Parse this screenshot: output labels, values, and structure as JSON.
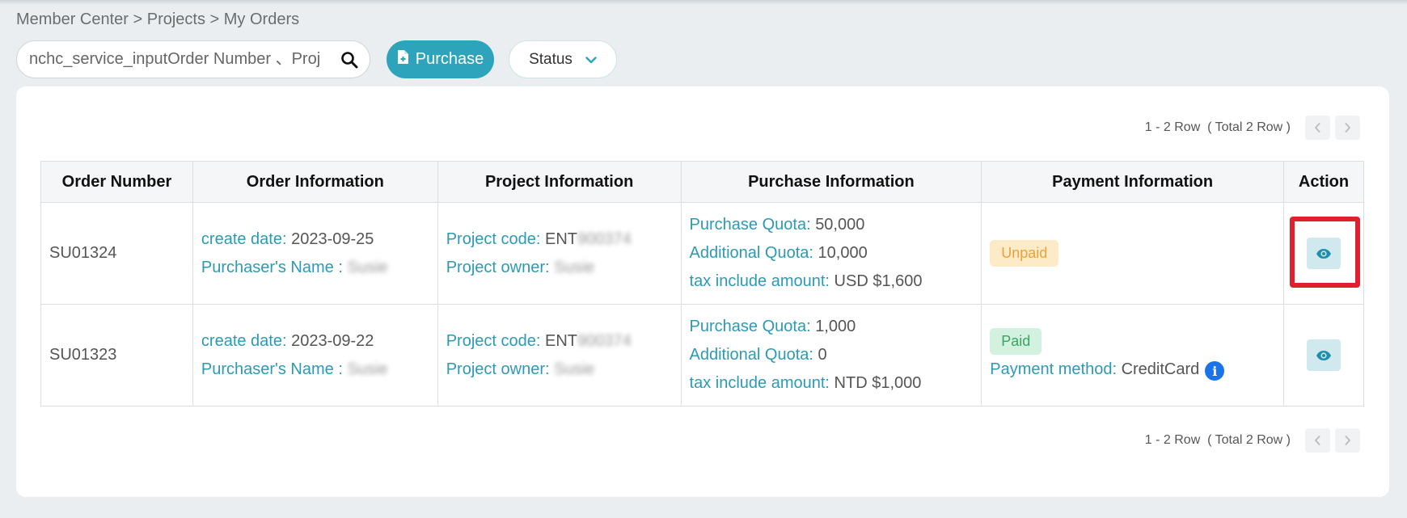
{
  "breadcrumb": "Member Center > Projects > My Orders",
  "search": {
    "placeholder": "nchc_service_inputOrder Number 、Project code",
    "value": ""
  },
  "toolbar": {
    "purchase_label": "Purchase",
    "status_label": "Status"
  },
  "pagination": {
    "range": "1 - 2 Row",
    "total": "( Total 2 Row )"
  },
  "table": {
    "headers": [
      "Order Number",
      "Order Information",
      "Project Information",
      "Purchase Information",
      "Payment Information",
      "Action"
    ],
    "labels": {
      "create_date": "create date: ",
      "purchaser": "Purchaser's Name : ",
      "project_code": "Project code: ",
      "project_owner": "Project owner: ",
      "purchase_quota": "Purchase Quota: ",
      "additional_quota": "Additional Quota: ",
      "tax_amount": "tax include amount: ",
      "payment_method": "Payment method: "
    },
    "rows": [
      {
        "order_number": "SU01324",
        "create_date": "2023-09-25",
        "purchaser": "Susie",
        "project_code_prefix": "ENT",
        "project_code_rest": "900374",
        "project_owner": "Susie",
        "purchase_quota": "50,000",
        "additional_quota": "10,000",
        "tax_amount": "USD $1,600",
        "status": "Unpaid"
      },
      {
        "order_number": "SU01323",
        "create_date": "2023-09-22",
        "purchaser": "Susie",
        "project_code_prefix": "ENT",
        "project_code_rest": "900374",
        "project_owner": "Susie",
        "purchase_quota": "1,000",
        "additional_quota": "0",
        "tax_amount": "NTD $1,000",
        "status": "Paid",
        "payment_method": "CreditCard"
      }
    ]
  },
  "colors": {
    "accent": "#2ea3bc",
    "highlight": "#e0202d",
    "unpaid": "#eaa13b",
    "paid": "#37a664"
  }
}
